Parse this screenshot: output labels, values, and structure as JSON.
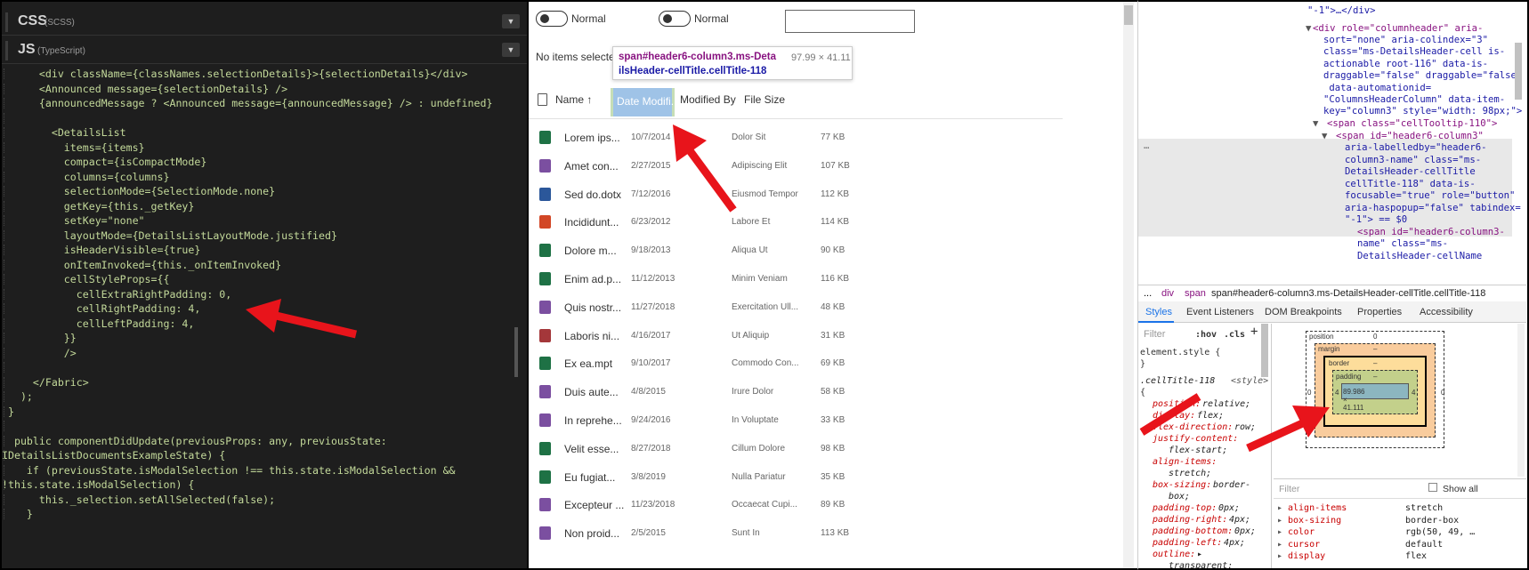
{
  "editor": {
    "css_title": "CSS",
    "css_sub": "(SCSS)",
    "js_title": "JS",
    "js_sub": "(TypeScript)",
    "chevron_icon": "chevron-down-icon",
    "code_lines": [
      "      <div className={classNames.selectionDetails}>{selectionDetails}</div>",
      "      <Announced message={selectionDetails} />",
      "      {announcedMessage ? <Announced message={announcedMessage} /> : undefined}",
      "",
      "        <DetailsList",
      "          items={items}",
      "          compact={isCompactMode}",
      "          columns={columns}",
      "          selectionMode={SelectionMode.none}",
      "          getKey={this._getKey}",
      "          setKey=\"none\"",
      "          layoutMode={DetailsListLayoutMode.justified}",
      "          isHeaderVisible={true}",
      "          onItemInvoked={this._onItemInvoked}",
      "          cellStyleProps={{",
      "            cellExtraRightPadding: 0,",
      "            cellRightPadding: 4,",
      "            cellLeftPadding: 4,",
      "          }}",
      "          />",
      "",
      "     </Fabric>",
      "   );",
      " }",
      "",
      "  public componentDidUpdate(previousProps: any, previousState:",
      "IDetailsListDocumentsExampleState) {",
      "    if (previousState.isModalSelection !== this.state.isModalSelection &&",
      "!this.state.isModalSelection) {",
      "      this._selection.setAllSelected(false);",
      "    }"
    ]
  },
  "preview": {
    "toggle1_label": "Normal",
    "toggle2_label": "Normal",
    "no_items": "No items selected",
    "tooltip": {
      "selector_line1": "span#header6-column3.ms-Deta",
      "selector_line2": "ilsHeader-cellTitle.cellTitle-118",
      "dimensions": "97.99 × 41.11"
    },
    "columns": [
      "Name ↑",
      "Date Modifi...",
      "Modified By",
      "File Size"
    ],
    "rows": [
      {
        "name": "Lorem ips...",
        "date": "10/7/2014",
        "by": "Dolor Sit",
        "size": "77 KB",
        "color": "#1e7145"
      },
      {
        "name": "Amet con...",
        "date": "2/27/2015",
        "by": "Adipiscing Elit",
        "size": "107 KB",
        "color": "#7b4fa0"
      },
      {
        "name": "Sed do.dotx",
        "date": "7/12/2016",
        "by": "Eiusmod Tempor",
        "size": "112 KB",
        "color": "#2b579a"
      },
      {
        "name": "Incididunt...",
        "date": "6/23/2012",
        "by": "Labore Et",
        "size": "114 KB",
        "color": "#d24726"
      },
      {
        "name": "Dolore m...",
        "date": "9/18/2013",
        "by": "Aliqua Ut",
        "size": "90 KB",
        "color": "#1e7145"
      },
      {
        "name": "Enim ad.p...",
        "date": "11/12/2013",
        "by": "Minim Veniam",
        "size": "116 KB",
        "color": "#1e7145"
      },
      {
        "name": "Quis nostr...",
        "date": "11/27/2018",
        "by": "Exercitation Ull...",
        "size": "48 KB",
        "color": "#7b4fa0"
      },
      {
        "name": "Laboris ni...",
        "date": "4/16/2017",
        "by": "Ut Aliquip",
        "size": "31 KB",
        "color": "#a4373a"
      },
      {
        "name": "Ex ea.mpt",
        "date": "9/10/2017",
        "by": "Commodo Con...",
        "size": "69 KB",
        "color": "#1e7145"
      },
      {
        "name": "Duis aute...",
        "date": "4/8/2015",
        "by": "Irure Dolor",
        "size": "58 KB",
        "color": "#7b4fa0"
      },
      {
        "name": "In reprehe...",
        "date": "9/24/2016",
        "by": "In Voluptate",
        "size": "33 KB",
        "color": "#7b4fa0"
      },
      {
        "name": "Velit esse...",
        "date": "8/27/2018",
        "by": "Cillum Dolore",
        "size": "98 KB",
        "color": "#1e7145"
      },
      {
        "name": "Eu fugiat...",
        "date": "3/8/2019",
        "by": "Nulla Pariatur",
        "size": "35 KB",
        "color": "#1e7145"
      },
      {
        "name": "Excepteur ...",
        "date": "11/23/2018",
        "by": "Occaecat Cupi...",
        "size": "89 KB",
        "color": "#7b4fa0"
      },
      {
        "name": "Non proid...",
        "date": "2/5/2015",
        "by": "Sunt In",
        "size": "113 KB",
        "color": "#7b4fa0"
      }
    ]
  },
  "devtools": {
    "crumbs": [
      "...",
      "div",
      "span",
      "span#header6-column3.ms-DetailsHeader-cellTitle.cellTitle-118"
    ],
    "tabs": [
      "Styles",
      "Event Listeners",
      "DOM Breakpoints",
      "Properties",
      "Accessibility"
    ],
    "filter_placeholder": "Filter",
    "hov": ":hov",
    "cls": ".cls",
    "element_style": "element.style {",
    "element_style_close": "}",
    "rule_selector": ".cellTitle-118",
    "rule_source": "<style>",
    "rule_open": "{",
    "declarations": [
      {
        "prop": "position",
        "val": "relative;"
      },
      {
        "prop": "display",
        "val": "flex;"
      },
      {
        "prop": "flex-direction",
        "val": "row;"
      },
      {
        "prop": "justify-content",
        "val": ""
      },
      {
        "prop": "",
        "val": "flex-start;"
      },
      {
        "prop": "align-items",
        "val": ""
      },
      {
        "prop": "",
        "val": "stretch;"
      },
      {
        "prop": "box-sizing",
        "val": "border-"
      },
      {
        "prop": "",
        "val": "box;"
      },
      {
        "prop": "padding-top",
        "val": "0px;"
      },
      {
        "prop": "padding-right",
        "val": "4px;"
      },
      {
        "prop": "padding-bottom",
        "val": "0px;"
      },
      {
        "prop": "padding-left",
        "val": "4px;"
      },
      {
        "prop": "outline",
        "val": "▸"
      },
      {
        "prop": "",
        "val": "transparent;"
      }
    ],
    "box_model": {
      "position_label": "position",
      "position_val": "0",
      "margin_label": "margin",
      "margin_val": "–",
      "border_label": "border",
      "border_val": "–",
      "padding_label": "padding",
      "padding_val": "–",
      "content": "89.986 × 41.111",
      "left_outer": "0",
      "right_outer": "0",
      "left_pad": "4",
      "right_pad": "4"
    },
    "computed_filter": "Filter",
    "show_all": "Show all",
    "computed": [
      {
        "prop": "align-items",
        "val": "stretch"
      },
      {
        "prop": "box-sizing",
        "val": "border-box"
      },
      {
        "prop": "color",
        "val": "rgb(50, 49, …"
      },
      {
        "prop": "cursor",
        "val": "default"
      },
      {
        "prop": "display",
        "val": "flex"
      }
    ],
    "elements_lines": [
      "\"-1\">…</div>",
      "<div role=\"columnheader\" aria-",
      "sort=\"none\" aria-colindex=\"3\"",
      "class=\"ms-DetailsHeader-cell is-",
      "actionable root-116\" data-is-",
      "draggable=\"false\" draggable=\"false\"",
      " data-automationid=",
      "\"ColumnsHeaderColumn\" data-item-",
      "key=\"column3\" style=\"width: 98px;\">",
      "<span class=\"cellTooltip-110\">",
      "<span id=\"header6-column3\"",
      "aria-labelledby=\"header6-",
      "column3-name\" class=\"ms-",
      "DetailsHeader-cellTitle",
      "cellTitle-118\" data-is-",
      "focusable=\"true\" role=\"button\"",
      "aria-haspopup=\"false\" tabindex=",
      "\"-1\"> == $0",
      "<span id=\"header6-column3-",
      "name\" class=\"ms-",
      "DetailsHeader-cellName"
    ]
  },
  "colors": {
    "annotation_arrow": "#e8141b",
    "highlight": "#9fc3e7"
  }
}
